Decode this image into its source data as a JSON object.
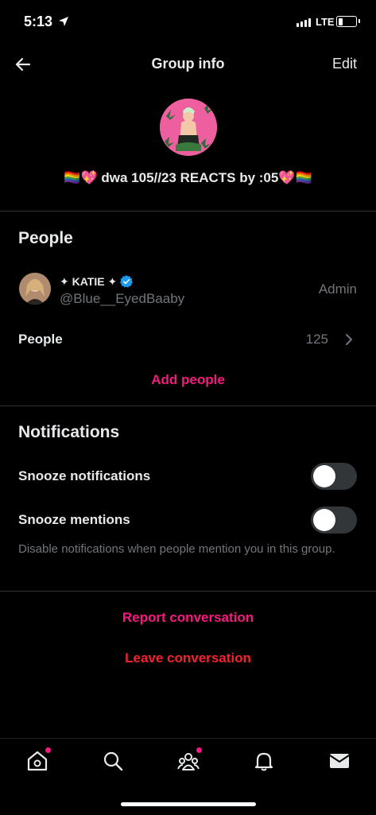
{
  "status_bar": {
    "time": "5:13",
    "network": "LTE"
  },
  "nav": {
    "title": "Group info",
    "edit_label": "Edit"
  },
  "group": {
    "name": "🏳‍🌈💖 dwa 105//23 REACTS by :05💖🏳‍🌈"
  },
  "people_section": {
    "title": "People",
    "member": {
      "name": "✦ KATIE ✦",
      "handle": "@Blue__EyedBaaby",
      "role": "Admin"
    },
    "people_row_label": "People",
    "people_count": "125",
    "add_people_label": "Add people"
  },
  "notifications_section": {
    "title": "Notifications",
    "snooze_notifications_label": "Snooze notifications",
    "snooze_mentions_label": "Snooze mentions",
    "hint": "Disable notifications when people mention you in this group."
  },
  "actions": {
    "report_label": "Report conversation",
    "leave_label": "Leave conversation"
  },
  "tabbar": {
    "items": [
      {
        "icon": "home-icon",
        "badge": true
      },
      {
        "icon": "search-icon",
        "badge": false
      },
      {
        "icon": "communities-icon",
        "badge": true
      },
      {
        "icon": "bell-icon",
        "badge": false
      },
      {
        "icon": "mail-icon",
        "badge": false
      }
    ]
  },
  "colors": {
    "accent": "#f91880",
    "danger": "#f4212e",
    "muted": "#71767b",
    "verified": "#1d9bf0"
  }
}
